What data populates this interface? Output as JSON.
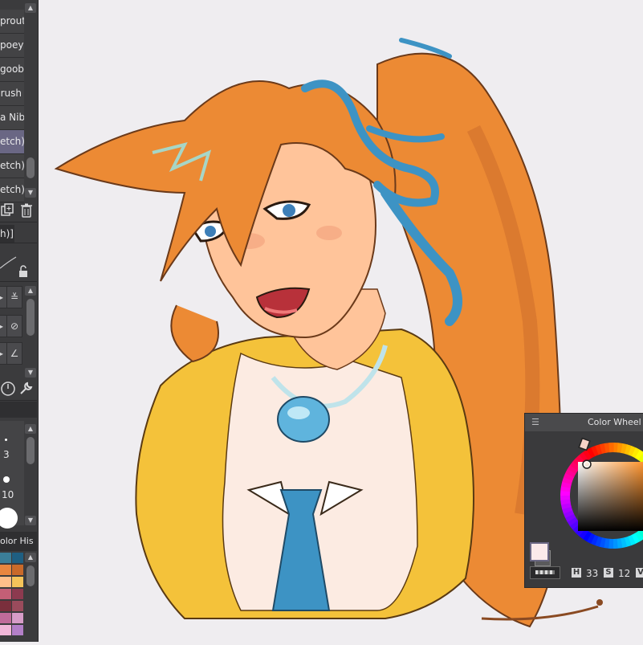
{
  "brush_list": {
    "items": [
      {
        "label": "Sprout",
        "visible_text": "prout"
      },
      {
        "label": "Spoey",
        "visible_text": "poey"
      },
      {
        "label": "Goob",
        "visible_text": "goob"
      },
      {
        "label": "Brush",
        "visible_text": "rush"
      },
      {
        "label": "Nib",
        "visible_text": "a Nib"
      },
      {
        "label": "(sketch)",
        "visible_text": "etch)"
      },
      {
        "label": "(sketch)",
        "visible_text": "etch)"
      },
      {
        "label": "(sketch)",
        "visible_text": "etch)"
      }
    ],
    "selected_index": 5
  },
  "sub_tool_tab": {
    "label": "h)]"
  },
  "brush_sizes": {
    "values": [
      "3",
      "10"
    ]
  },
  "color_history": {
    "tab_label": "olor His",
    "swatches": [
      "#3b7e98",
      "#1f5f82",
      "#e8863f",
      "#c96a2a",
      "#ffbf8a",
      "#f5c45a",
      "#c35f76",
      "#8c3a4f",
      "#7a2f3c",
      "#9a4b5c",
      "#c06b9a",
      "#d79cc8",
      "#f0b6d8",
      "#b37fc8"
    ]
  },
  "color_wheel": {
    "title": "Color Wheel",
    "menu_icon": "hamburger-icon",
    "main_color": "#fbeaea",
    "sub_color": "#5a5a5c",
    "h_label": "H",
    "h_value": "33",
    "s_label": "S",
    "s_value": "12",
    "v_label": "V"
  },
  "colors": {
    "panel_bg": "#3b3b3d",
    "canvas_bg": "#efedf0",
    "selected_item": "#6a6784",
    "hair": "#ec8a34",
    "ribbon": "#3d93c4",
    "jacket": "#f4c23a"
  }
}
